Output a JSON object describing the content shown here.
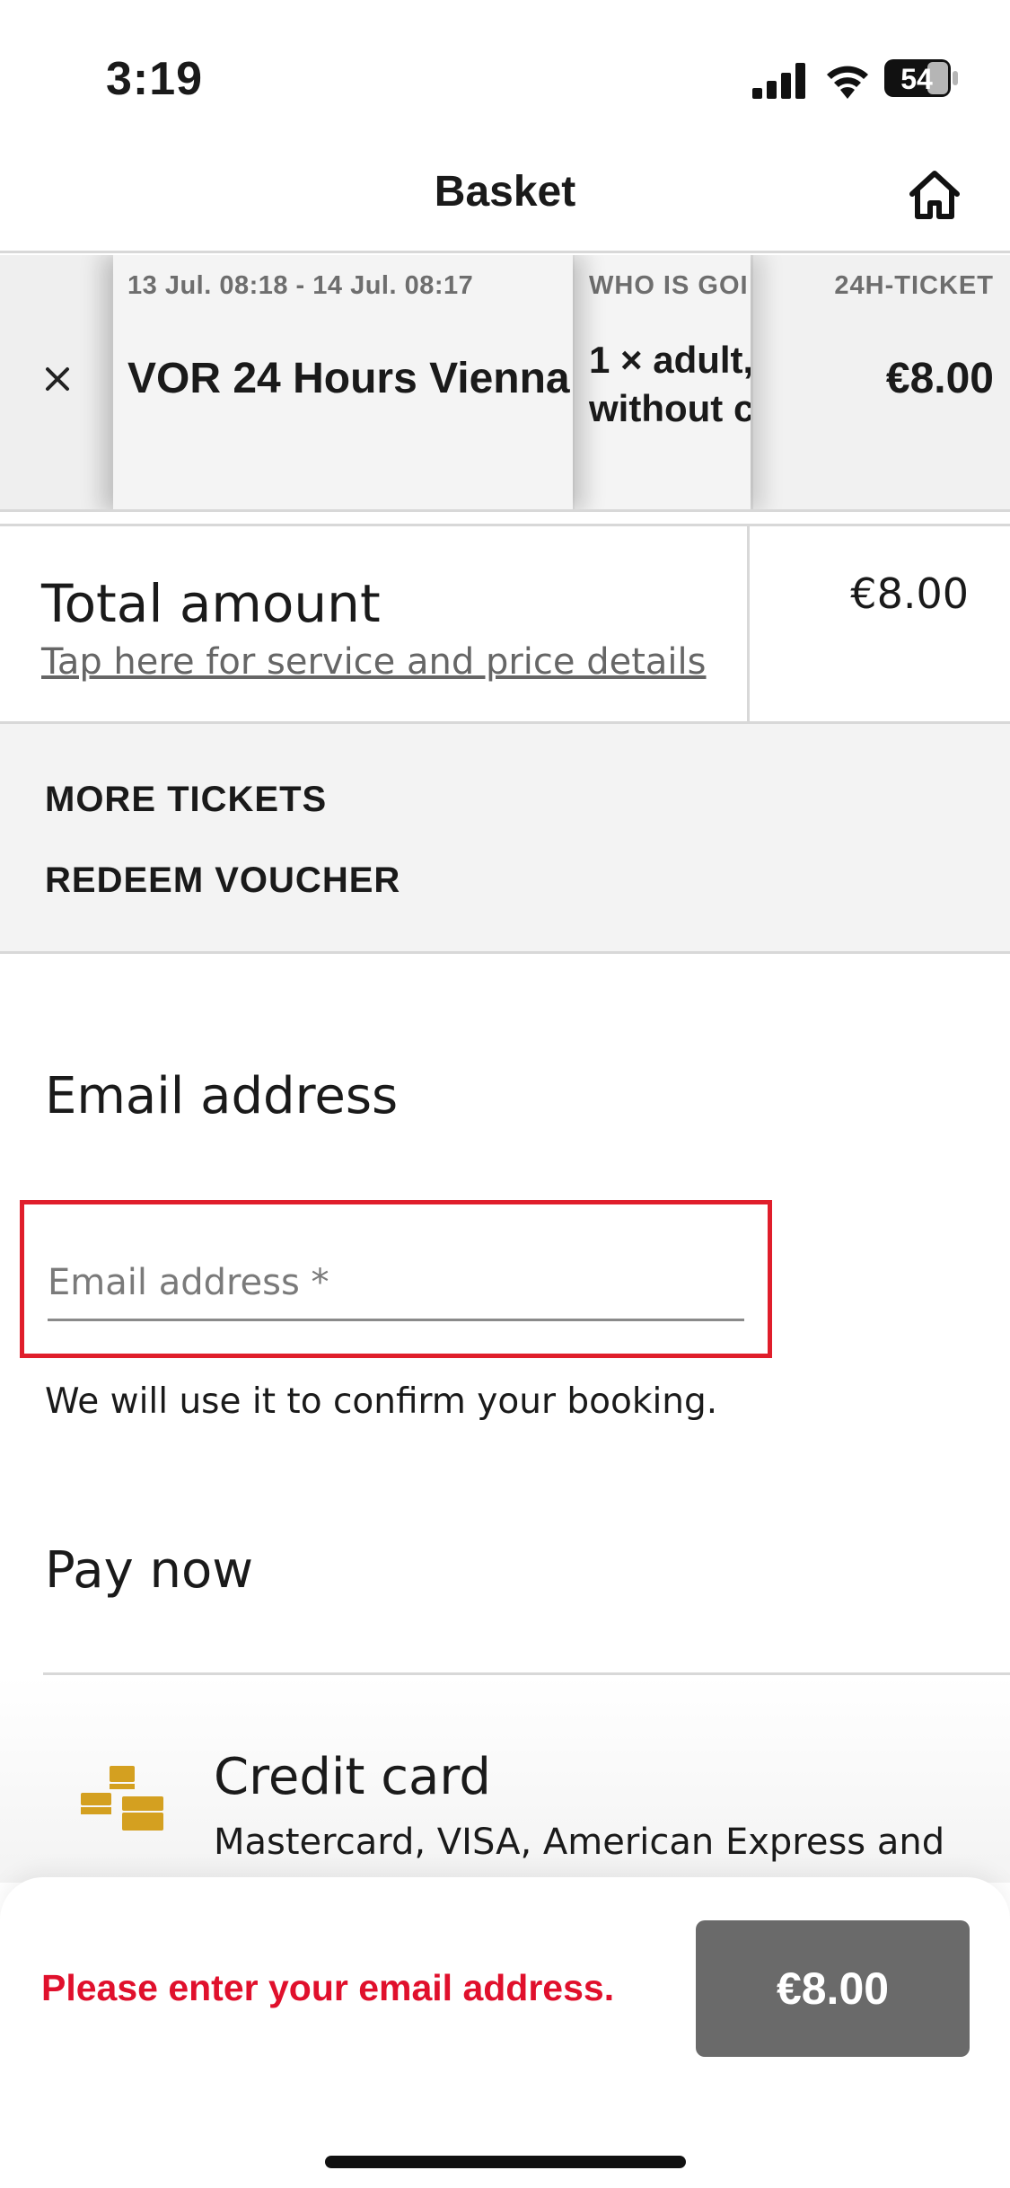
{
  "status_bar": {
    "time": "3:19",
    "battery": "54"
  },
  "header": {
    "title": "Basket",
    "home_icon": "home-icon"
  },
  "ticket": {
    "validity": "13 Jul. 08:18 - 14 Jul. 08:17",
    "name": "VOR 24 Hours Vienna",
    "who_header": "WHO IS GOI",
    "who_line1": "1 × adult,",
    "who_line2": "without c",
    "type_header": "24H-TICKET",
    "price": "€8.00",
    "remove_icon": "close-icon"
  },
  "total": {
    "label": "Total amount",
    "details_link": "Tap here for service and price details",
    "value": "€8.00"
  },
  "actions": {
    "more_tickets": "MORE TICKETS",
    "redeem_voucher": "REDEEM VOUCHER"
  },
  "email": {
    "heading": "Email address",
    "placeholder": "Email address *",
    "value": "",
    "help": "We will use it to confirm your booking."
  },
  "payment": {
    "heading": "Pay now",
    "option_title": "Credit card",
    "option_desc": "Mastercard, VISA, American Express and",
    "icon": "credit-card-icon",
    "icon_color": "#d4a020"
  },
  "footer": {
    "error": "Please enter your email address.",
    "error_color": "#e0102c",
    "button_label": "€8.00"
  }
}
